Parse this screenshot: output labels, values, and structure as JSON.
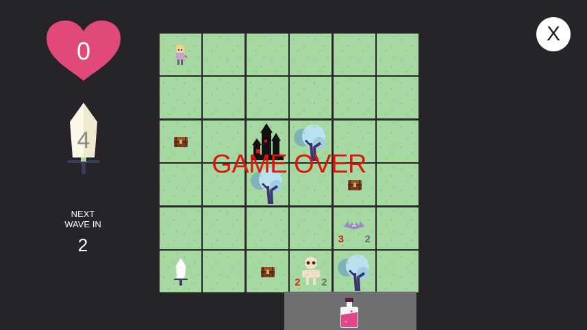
{
  "hud": {
    "lives": "0",
    "attack": "4",
    "wave_label_line1": "NEXT",
    "wave_label_line2": "WAVE IN",
    "wave_countdown": "2",
    "close_label": "X"
  },
  "overlay": {
    "message": "GAME OVER"
  },
  "board": {
    "rows": 6,
    "cols": 6,
    "entities": [
      {
        "type": "hero",
        "row": 0,
        "col": 0,
        "icon": "hero-icon"
      },
      {
        "type": "chest",
        "row": 2,
        "col": 0,
        "icon": "treasure-chest-icon"
      },
      {
        "type": "castle",
        "row": 2,
        "col": 2,
        "icon": "castle-icon"
      },
      {
        "type": "tree",
        "row": 2,
        "col": 3,
        "icon": "tree-icon"
      },
      {
        "type": "tree",
        "row": 3,
        "col": 2,
        "icon": "tree-icon"
      },
      {
        "type": "chest",
        "row": 3,
        "col": 4,
        "icon": "treasure-chest-icon"
      },
      {
        "type": "bat",
        "row": 4,
        "col": 4,
        "icon": "bat-icon",
        "attack": "3",
        "hp": "2"
      },
      {
        "type": "sword",
        "row": 5,
        "col": 0,
        "icon": "sword-pickup-icon"
      },
      {
        "type": "chest",
        "row": 5,
        "col": 2,
        "icon": "treasure-chest-icon"
      },
      {
        "type": "skeleton",
        "row": 5,
        "col": 3,
        "icon": "skeleton-icon",
        "attack": "2",
        "hp": "2"
      },
      {
        "type": "tree",
        "row": 5,
        "col": 4,
        "icon": "tree-icon"
      }
    ]
  },
  "inventory": {
    "item": "health-potion-icon"
  },
  "colors": {
    "background": "#262428",
    "grass": "#a6d8a2",
    "heart": "#e04a78",
    "game_over": "#e0140c",
    "attack_text": "#d4241a",
    "tray": "#6e6e70"
  }
}
